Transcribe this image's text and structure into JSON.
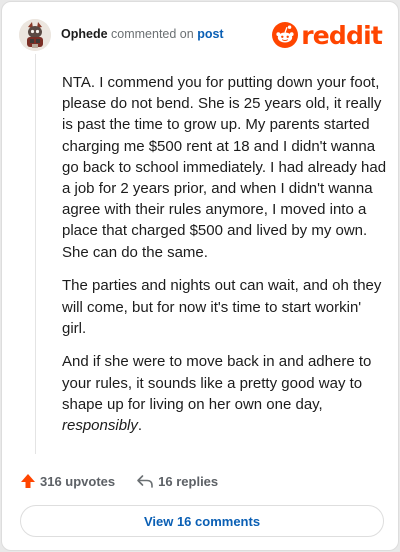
{
  "header": {
    "username": "Ophede",
    "action_text": "commented on",
    "post_link": "post",
    "brand": "reddit"
  },
  "comment": {
    "paragraph_1": "NTA. I commend you for putting down your foot, please do not bend. She is 25 years old, it really is past the time to grow up. My parents started charging me $500 rent at 18 and I didn't wanna go back to school immediately. I had already had a job for 2 years prior, and when I didn't wanna agree with their rules anymore, I moved into a place that charged $500 and lived by my own. She can do the same.",
    "paragraph_2": "The parties and nights out can wait, and oh they will come, but for now it's time to start workin' girl.",
    "paragraph_3_text": "And if she were to move back in and adhere to your rules, it sounds like a pretty good way to shape up for living on her own one day, ",
    "paragraph_3_emphasis": "responsibly",
    "paragraph_3_end": "."
  },
  "actions": {
    "upvotes": "316 upvotes",
    "replies": "16 replies"
  },
  "footer": {
    "view_comments": "View 16 comments"
  },
  "colors": {
    "brand": "#ff4500",
    "link": "#0a5fb4",
    "text": "#1c1c1c"
  },
  "icons": {
    "upvote": "upvote-arrow-icon",
    "reply": "reply-arrow-icon",
    "logo": "snoo-icon"
  }
}
